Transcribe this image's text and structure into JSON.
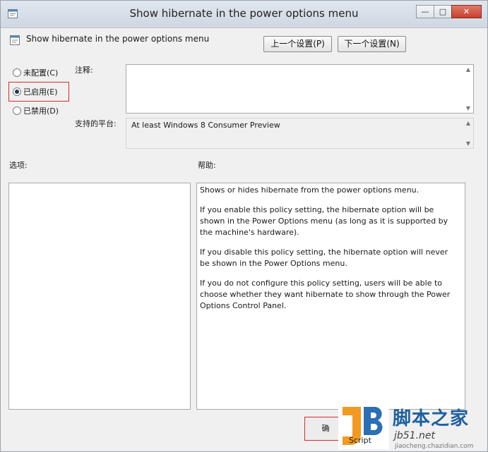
{
  "window": {
    "title": "Show hibernate in the power options menu",
    "buttons": {
      "minimize": "—",
      "maximize": "□",
      "close": "✕"
    }
  },
  "policy": {
    "name": "Show hibernate in the power options menu",
    "prev_button": "上一个设置(P)",
    "next_button": "下一个设置(N)"
  },
  "state": {
    "options": [
      {
        "label": "未配置(C)",
        "selected": false
      },
      {
        "label": "已启用(E)",
        "selected": true
      },
      {
        "label": "已禁用(D)",
        "selected": false
      }
    ]
  },
  "comment": {
    "label": "注释:",
    "value": ""
  },
  "platform": {
    "label": "支持的平台:",
    "value": "At least Windows 8 Consumer Preview"
  },
  "options_label": "选项:",
  "help_label": "帮助:",
  "help": [
    "Shows or hides hibernate from the power options menu.",
    "If you enable this policy setting, the hibernate option will be shown in the Power Options menu (as long as it is supported by the machine's hardware).",
    "If you disable this policy setting, the hibernate option will never be shown in the Power Options menu.",
    "If you do not configure this policy setting, users will be able to choose whether they want hibernate to show through the Power Options Control Panel."
  ],
  "footer": {
    "ok_button": "确"
  },
  "watermark": {
    "title": "脚本之家",
    "subtitle": "jb51.net",
    "script": "Script",
    "url": "jiaocheng.chazidian.com"
  },
  "colors": {
    "highlight": "#d0302a",
    "watermark": "#1e5f9e"
  }
}
